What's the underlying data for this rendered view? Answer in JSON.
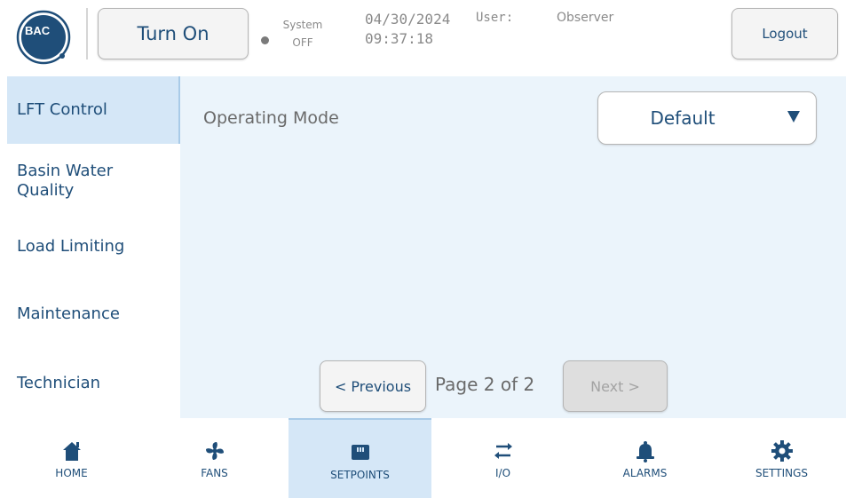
{
  "header": {
    "logo_text": "BAC",
    "turn_on_label": "Turn On",
    "system_label": "System",
    "system_state": "OFF",
    "date": "04/30/2024",
    "time": "09:37:18",
    "user_label": "User:",
    "user_value": "Observer",
    "logout_label": "Logout"
  },
  "sidebar": {
    "items": [
      {
        "label": "LFT Control",
        "active": true
      },
      {
        "label": "Basin Water Quality",
        "active": false
      },
      {
        "label": "Load Limiting",
        "active": false
      },
      {
        "label": "Maintenance",
        "active": false
      },
      {
        "label": "Technician",
        "active": false
      }
    ]
  },
  "main": {
    "operating_mode_label": "Operating Mode",
    "operating_mode_value": "Default",
    "pagination": {
      "previous_label": "< Previous",
      "page_info": "Page 2 of 2",
      "next_label": "Next >",
      "next_disabled": true
    }
  },
  "bottom_nav": {
    "items": [
      {
        "label": "HOME",
        "icon": "home-icon",
        "active": false
      },
      {
        "label": "FANS",
        "icon": "fan-icon",
        "active": false
      },
      {
        "label": "SETPOINTS",
        "icon": "setpoints-icon",
        "active": true
      },
      {
        "label": "I/O",
        "icon": "io-arrows-icon",
        "active": false
      },
      {
        "label": "ALARMS",
        "icon": "bell-icon",
        "active": false
      },
      {
        "label": "SETTINGS",
        "icon": "gear-icon",
        "active": false
      }
    ]
  },
  "colors": {
    "brand_blue": "#1f4e79",
    "panel_bg": "#ebf4fb",
    "active_bg": "#d5e7f7",
    "muted_text": "#8a8a8a"
  }
}
